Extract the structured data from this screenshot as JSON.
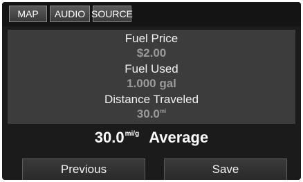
{
  "tabs": [
    {
      "label": "MAP"
    },
    {
      "label": "AUDIO"
    },
    {
      "label": "SOURCE"
    }
  ],
  "trip": {
    "fuel_price_label": "Fuel Price",
    "fuel_price_value": "$2.00",
    "fuel_used_label": "Fuel Used",
    "fuel_used_value": "1.000 gal",
    "distance_label": "Distance Traveled",
    "distance_value": "30.0",
    "distance_unit": "mi"
  },
  "average": {
    "value": "30.0",
    "unit": "mi/g",
    "label": "Average"
  },
  "buttons": {
    "previous": "Previous",
    "save": "Save"
  }
}
